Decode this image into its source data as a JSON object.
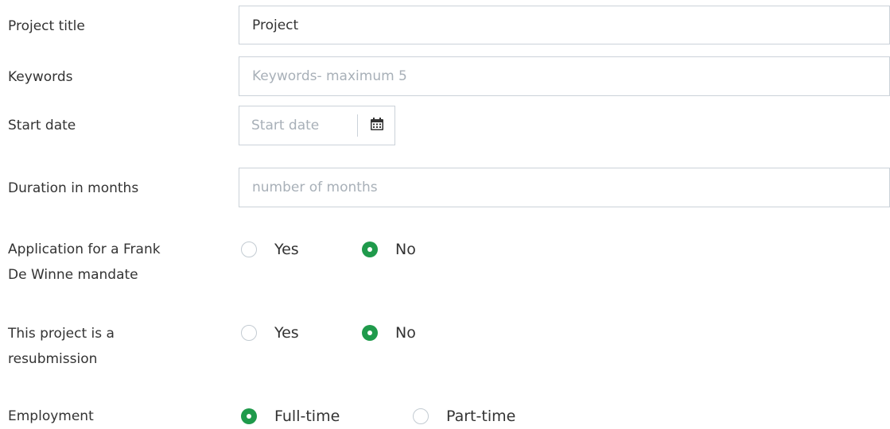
{
  "form": {
    "project_title": {
      "label": "Project title",
      "value": "Project"
    },
    "keywords": {
      "label": "Keywords",
      "placeholder": "Keywords- maximum 5"
    },
    "start_date": {
      "label": "Start date",
      "placeholder": "Start date",
      "icon": "calendar-icon"
    },
    "duration": {
      "label": "Duration in months",
      "placeholder": "number of months"
    },
    "frank_de_winne": {
      "label_line1": "Application for a Frank",
      "label_line2": "De Winne mandate",
      "options": [
        "Yes",
        "No"
      ],
      "selected": "No"
    },
    "resubmission": {
      "label_line1": "This project is a",
      "label_line2": "resubmission",
      "options": [
        "Yes",
        "No"
      ],
      "selected": "No"
    },
    "employment": {
      "label": "Employment",
      "options": [
        "Full-time",
        "Part-time"
      ],
      "selected": "Full-time"
    }
  },
  "colors": {
    "accent": "#1f9a4b",
    "border": "#cbd2d9",
    "placeholder": "#a8b0b8",
    "text": "#333333"
  }
}
